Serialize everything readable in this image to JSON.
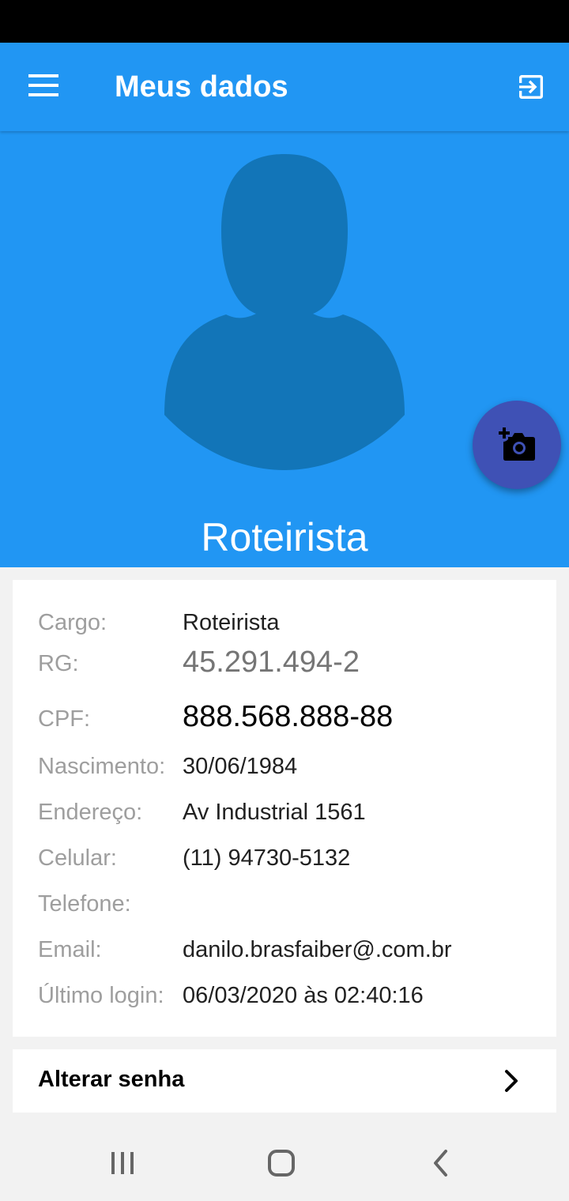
{
  "app_bar": {
    "title": "Meus dados",
    "menu_icon": "hamburger-menu-icon",
    "logout_icon": "exit-to-app-icon"
  },
  "profile": {
    "name": "Roteirista",
    "avatar_icon": "person-silhouette-icon",
    "camera_icon": "add-a-photo-icon"
  },
  "info": {
    "cargo_label": "Cargo:",
    "cargo_value": "Roteirista",
    "rg_label": "RG:",
    "rg_value": "45.291.494-2",
    "cpf_label": "CPF:",
    "cpf_value": "888.568.888-88",
    "nascimento_label": "Nascimento:",
    "nascimento_value": "30/06/1984",
    "endereco_label": "Endereço:",
    "endereco_value": "Av Industrial 1561",
    "celular_label": "Celular:",
    "celular_value": "(11) 94730-5132",
    "telefone_label": "Telefone:",
    "telefone_value": "",
    "email_label": "Email:",
    "email_value": "danilo.brasfaiber@.com.br",
    "ultimo_login_label": "Último login:",
    "ultimo_login_value": "06/03/2020 às 02:40:16"
  },
  "actions": {
    "change_password_label": "Alterar senha"
  },
  "system_nav": {
    "recent_icon": "recent-apps-icon",
    "home_icon": "home-icon",
    "back_icon": "back-icon"
  },
  "colors": {
    "primary": "#2196f3",
    "avatar": "#1275b8",
    "fab": "#3f51b5"
  }
}
